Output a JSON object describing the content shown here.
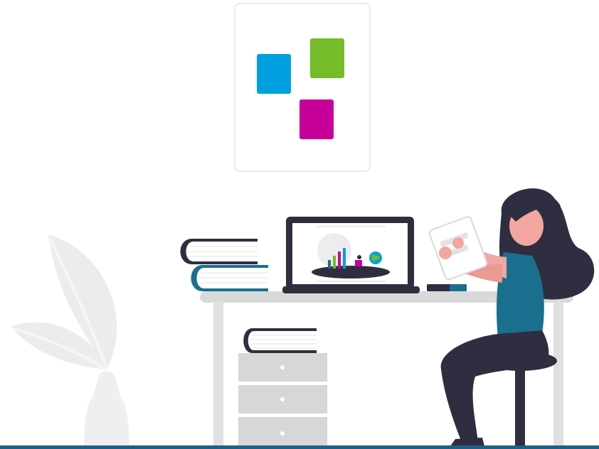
{
  "colors": {
    "background": "#ffffff",
    "tile_blue": "#00a0e0",
    "tile_green": "#76bb2a",
    "tile_magenta": "#c8009a",
    "accent_teal": "#1a6f8f",
    "dark_navy": "#2f2e41",
    "plant_gray": "#e6e6e6",
    "furniture_gray": "#dcdcdc",
    "bottom_bar": "#1f5f86"
  },
  "icons": {
    "logo": "three-colored-squares-logo",
    "illustration": "woman-at-desk-illustration"
  }
}
